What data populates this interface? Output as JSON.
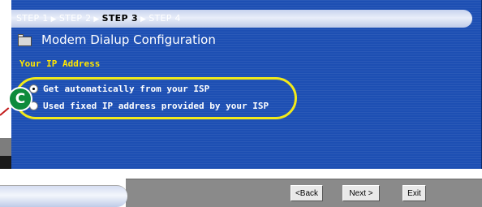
{
  "wizard": {
    "steps": [
      {
        "label": "STEP 1",
        "current": false
      },
      {
        "label": "STEP 2",
        "current": false
      },
      {
        "label": "STEP 3",
        "current": true
      },
      {
        "label": "STEP 4",
        "current": false
      }
    ],
    "title": "Modem Dialup Configuration",
    "section_label": "Your IP Address",
    "options": [
      {
        "label": "Get automatically from your ISP",
        "selected": true
      },
      {
        "label": "Used fixed IP address provided by your ISP",
        "selected": false
      }
    ]
  },
  "callout": {
    "label": "C",
    "oval_color": "#f2ea1a",
    "badge_color": "#0e8b3c"
  },
  "nav": {
    "back_label": "<Back",
    "next_label": "Next >",
    "exit_label": "Exit"
  },
  "colors": {
    "panel": "#1d4fb3",
    "section_label": "#ffe600"
  }
}
